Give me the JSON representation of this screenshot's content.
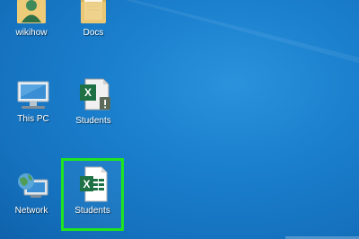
{
  "desktop": {
    "icons": [
      {
        "label": "wikihow",
        "icon": "user-folder-icon"
      },
      {
        "label": "Docs",
        "icon": "folder-icon"
      },
      {
        "label": "This PC",
        "icon": "computer-icon"
      },
      {
        "label": "Students",
        "icon": "excel-warning-file-icon"
      },
      {
        "label": "Network",
        "icon": "network-icon"
      },
      {
        "label": "Students",
        "icon": "excel-file-icon",
        "selected": true
      }
    ]
  },
  "colors": {
    "desktop_background": "#1a7fcd",
    "selection_border": "#1ee51e",
    "excel_green": "#1e7145",
    "folder_yellow": "#e8c26a"
  }
}
